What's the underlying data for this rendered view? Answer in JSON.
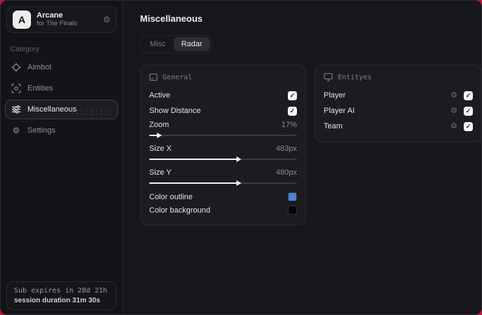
{
  "icons": {
    "check": "✓",
    "gear": "⚙"
  },
  "colors": {
    "accent_blue": "#4d82d6",
    "backdrop_red": "#c2183c"
  },
  "sidebar": {
    "header": {
      "logo_letter": "A",
      "title": "Arcane",
      "subtitle": "for The Finals"
    },
    "category_label": "Category",
    "items": [
      {
        "label": "Aimbot",
        "icon": "crosshair-icon",
        "active": false
      },
      {
        "label": "Entities",
        "icon": "scan-icon",
        "active": false
      },
      {
        "label": "Miscellaneous",
        "icon": "sliders-icon",
        "active": true
      },
      {
        "label": "Settings",
        "icon": "gear-icon",
        "active": false
      }
    ],
    "footer": {
      "line1": "Sub expires in 28d 21h",
      "line2": "session duration 31m 30s"
    }
  },
  "main": {
    "title": "Miscellaneous",
    "tabs": [
      {
        "label": "Misc",
        "active": false
      },
      {
        "label": "Radar",
        "active": true
      }
    ],
    "panels": {
      "general": {
        "title": "General",
        "rows": [
          {
            "label": "Active",
            "type": "checkbox",
            "checked": true
          },
          {
            "label": "Show Distance",
            "type": "checkbox",
            "checked": true
          },
          {
            "label": "Zoom",
            "type": "slider",
            "value": "17%",
            "fill": 6
          },
          {
            "label": "Size X",
            "type": "slider",
            "value": "483px",
            "fill": 60
          },
          {
            "label": "Size Y",
            "type": "slider",
            "value": "480px",
            "fill": 60
          },
          {
            "label": "Color outline",
            "type": "color",
            "color": "#4d82d6"
          },
          {
            "label": "Color background",
            "type": "color",
            "color": "#050505"
          }
        ]
      },
      "entities": {
        "title": "Entityes",
        "rows": [
          {
            "label": "Player",
            "checked": true
          },
          {
            "label": "Player AI",
            "checked": true
          },
          {
            "label": "Team",
            "checked": true
          }
        ]
      }
    }
  }
}
